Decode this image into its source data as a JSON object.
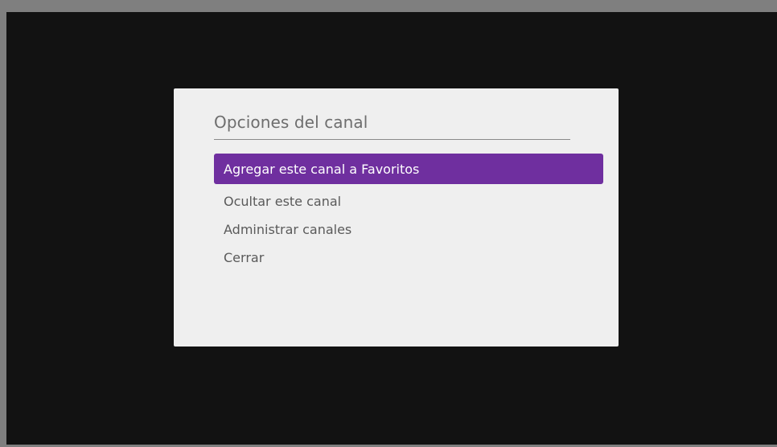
{
  "dialog": {
    "title": "Opciones del canal",
    "items": [
      {
        "label": "Agregar este canal a Favoritos",
        "selected": true
      },
      {
        "label": "Ocultar este canal",
        "selected": false
      },
      {
        "label": "Administrar canales",
        "selected": false
      },
      {
        "label": "Cerrar",
        "selected": false
      }
    ]
  },
  "colors": {
    "accent": "#6f2f9f",
    "dialog_background": "#efefef",
    "screen_background": "#121212"
  }
}
